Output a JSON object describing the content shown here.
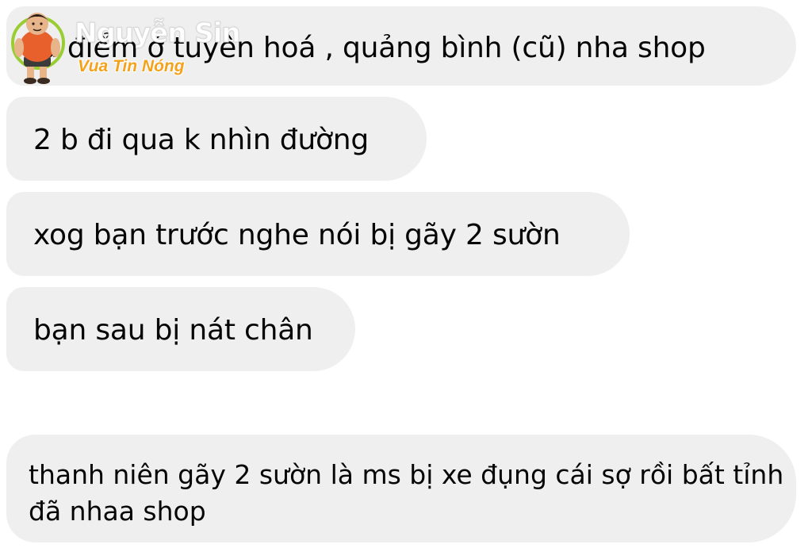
{
  "watermark": {
    "name": "Nguyễn Sin",
    "tagline": "Vua Tin Nóng"
  },
  "messages": [
    {
      "text": "ịa điểm ở tuyên hoá , quảng bình (cũ) nha shop"
    },
    {
      "text": "2 b đi qua k nhìn đường"
    },
    {
      "text": "xog bạn trước nghe nói bị gãy 2 sườn"
    },
    {
      "text": "bạn sau bị nát chân"
    }
  ],
  "reply": {
    "line1": "thanh niên gãy 2 sườn là ms bị xe đụng cái sợ rồi bất tỉnh",
    "line2": "đã nhaa shop"
  },
  "colors": {
    "bubble": "#efeff0",
    "text": "#050505",
    "tagline": "#f4a11c"
  }
}
